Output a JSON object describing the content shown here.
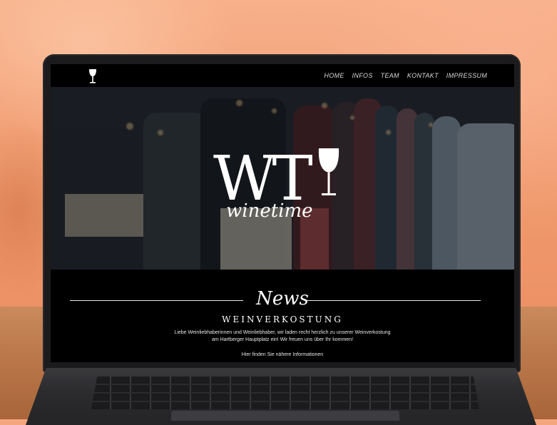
{
  "website": {
    "nav": {
      "logo_icon": "wine-glass-icon",
      "links": [
        "HOME",
        "INFOS",
        "TEAM",
        "KONTAKT",
        "IMPRESSUM"
      ]
    },
    "hero": {
      "logo_letters": "WT",
      "logo_script": "winetime",
      "logo_icon": "wine-glass-icon"
    },
    "news": {
      "heading": "News",
      "title": "WEINVERKOSTUNG",
      "text_line1": "Liebe Weinliebhaberinnen und Weinliebhaber, wir laden recht herzlich zu unserer Weinverkostung",
      "text_line2": "am Hartberger Hauptplatz ein! Wir freuen uns über Ihr kommen!",
      "link_text": "Hier finden Sie nähere Informationen"
    }
  },
  "colors": {
    "wall": "#f09a6e",
    "site_background": "#000000",
    "nav_text": "#d8d8d8"
  }
}
